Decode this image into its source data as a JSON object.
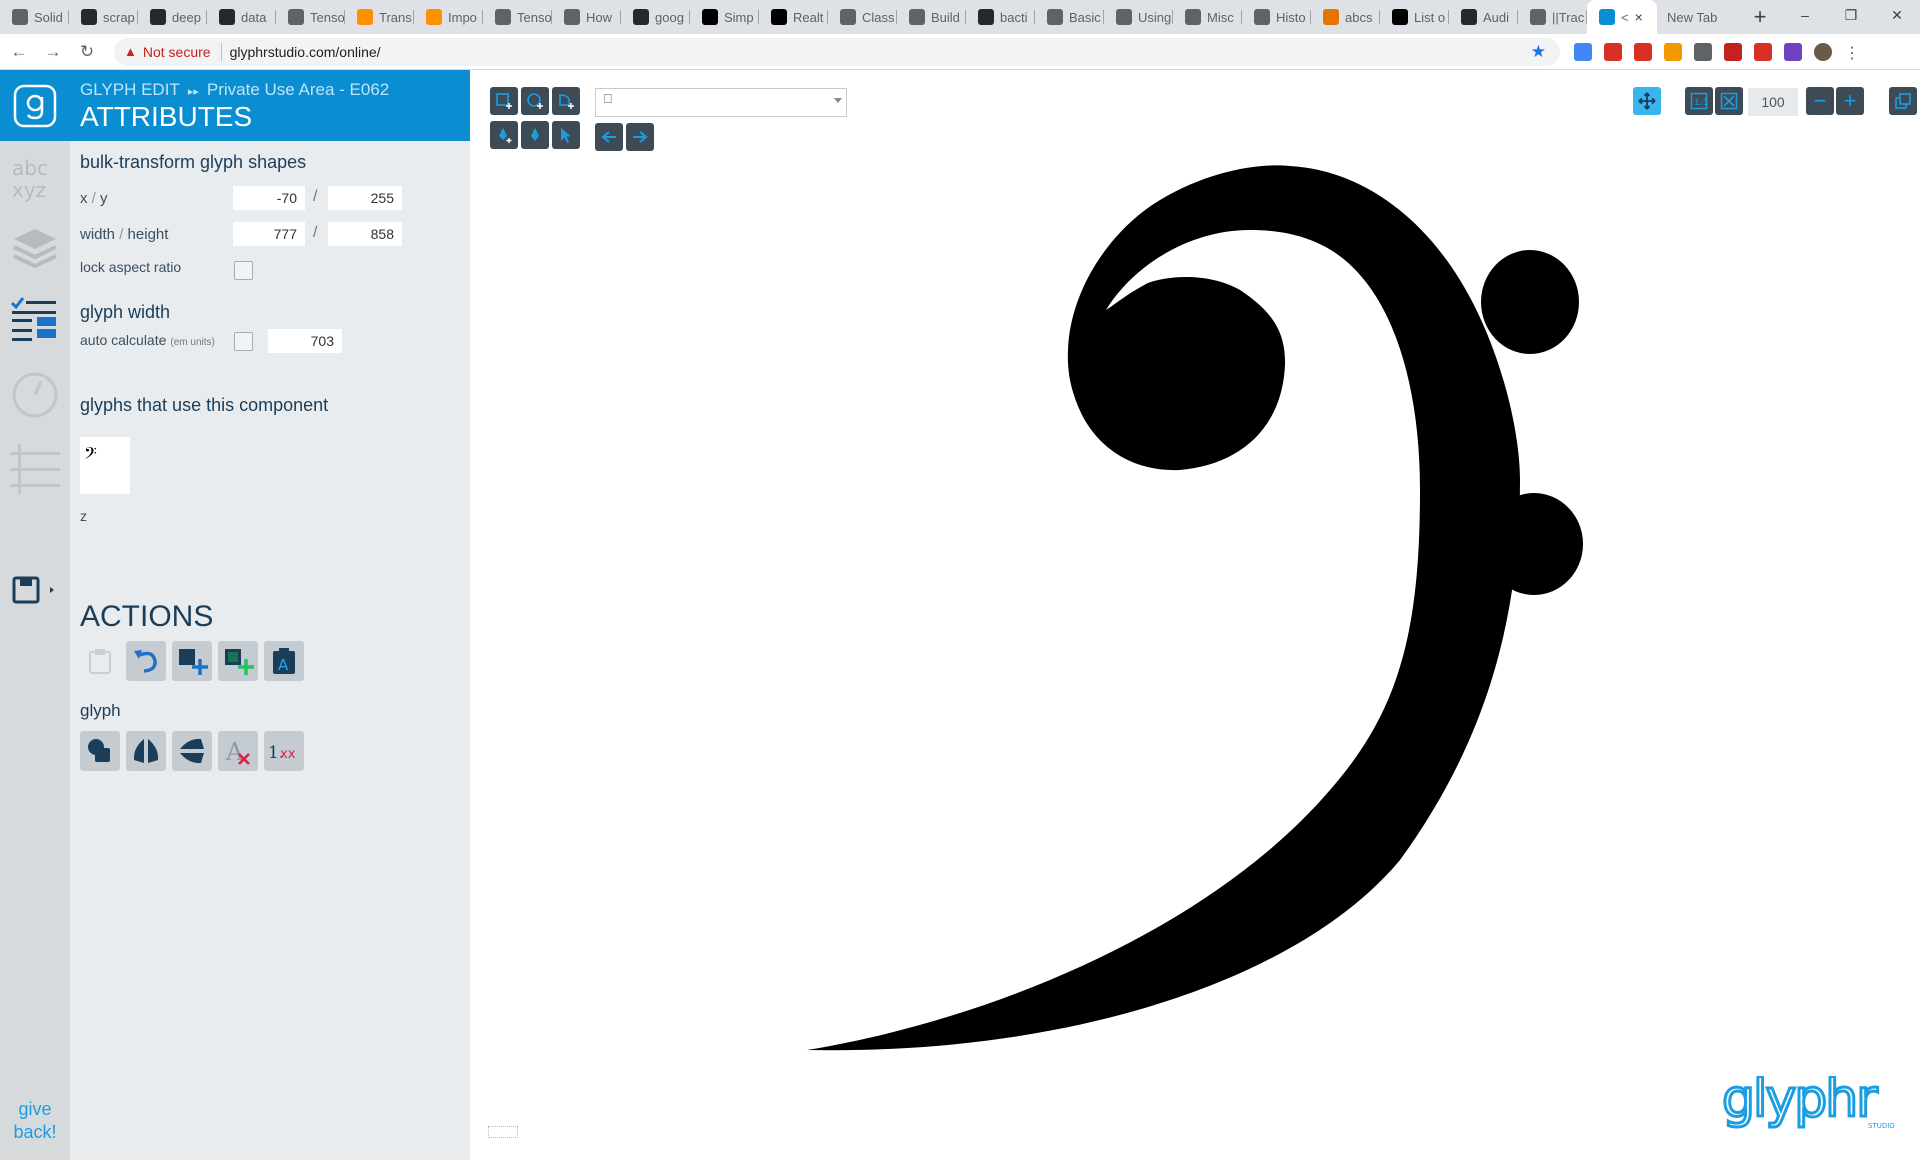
{
  "browser": {
    "tabs": [
      {
        "label": "Solid",
        "icon": "document-icon",
        "color": "#5f6368"
      },
      {
        "label": "scrap",
        "icon": "github-icon",
        "color": "#24292e"
      },
      {
        "label": "deep",
        "icon": "github-icon",
        "color": "#24292e"
      },
      {
        "label": "data",
        "icon": "github-icon",
        "color": "#24292e"
      },
      {
        "label": "Tenso",
        "icon": "globe-icon",
        "color": "#5f6368"
      },
      {
        "label": "Trans",
        "icon": "tensorflow-icon",
        "color": "#ff8f00"
      },
      {
        "label": "Impo",
        "icon": "tensorflow-icon",
        "color": "#ff8f00"
      },
      {
        "label": "Tenso",
        "icon": "code-icon",
        "color": "#5f6368"
      },
      {
        "label": "How",
        "icon": "circle-icon",
        "color": "#5f6368"
      },
      {
        "label": "goog",
        "icon": "github-icon",
        "color": "#24292e"
      },
      {
        "label": "Simp",
        "icon": "medium-icon",
        "color": "#000000"
      },
      {
        "label": "Realt",
        "icon": "medium-icon",
        "color": "#000000"
      },
      {
        "label": "Class",
        "icon": "globe-icon",
        "color": "#5f6368"
      },
      {
        "label": "Build",
        "icon": "book-icon",
        "color": "#5f6368"
      },
      {
        "label": "bacti",
        "icon": "github-icon",
        "color": "#24292e"
      },
      {
        "label": "Basic",
        "icon": "c-icon",
        "color": "#5f6368"
      },
      {
        "label": "Using",
        "icon": "c-icon",
        "color": "#5f6368"
      },
      {
        "label": "Misc",
        "icon": "globe-icon",
        "color": "#5f6368"
      },
      {
        "label": "Histo",
        "icon": "document-icon",
        "color": "#5f6368"
      },
      {
        "label": "abcs",
        "icon": "pencil-icon",
        "color": "#e37400"
      },
      {
        "label": "List o",
        "icon": "wikipedia-icon",
        "color": "#000000"
      },
      {
        "label": "Audi",
        "icon": "github-icon",
        "color": "#24292e"
      },
      {
        "label": "||Trac",
        "icon": "audio-icon",
        "color": "#5f6368"
      }
    ],
    "active_tab": {
      "label": "<",
      "close": "×",
      "icon": "glyphr-icon",
      "color": "#0a8ed1"
    },
    "new_tab": {
      "label": "New Tab"
    },
    "new_tab_button": "+",
    "window_controls": {
      "minimize": "–",
      "restore": "❐",
      "close": "✕"
    },
    "nav": {
      "back": "←",
      "forward": "→",
      "reload": "↻"
    },
    "address": {
      "warning_icon": "▲",
      "not_secure": "Not secure",
      "url": "glyphrstudio.com/online/",
      "star": "★"
    },
    "extensions": [
      "#4285f4",
      "#d93025",
      "#d93025",
      "#f29900",
      "#5f6368",
      "#c5221f",
      "#d93025",
      "#6f42c1"
    ]
  },
  "app": {
    "colors": {
      "accent": "#0a8ed1",
      "panel": "#e9ecee",
      "rail": "#d6dadd",
      "button": "#3d4b56"
    },
    "rail": {
      "give_back": "give back!"
    },
    "header": {
      "mode": "GLYPH EDIT",
      "location": "Private Use Area - E062",
      "title": "ATTRIBUTES",
      "separator": "▸▸"
    },
    "bulk": {
      "title": "bulk-transform glyph shapes",
      "xy_label": "x",
      "xy_sep": "/",
      "y_label": "y",
      "x": "-70",
      "y": "255",
      "wh_label": "width",
      "h_label": "height",
      "width": "777",
      "height": "858",
      "lock_label": "lock aspect ratio",
      "lock_checked": false
    },
    "glyph_width": {
      "title": "glyph width",
      "auto_label": "auto calculate",
      "auto_hint": "(em units)",
      "auto_checked": false,
      "value": "703"
    },
    "usage": {
      "title": "glyphs that use this component",
      "thumb_glyph": "𝄢",
      "item_label": "z"
    },
    "actions": {
      "title": "ACTIONS",
      "row1": [
        "paste-icon",
        "undo-icon",
        "add-shape-icon",
        "add-component-icon",
        "paste-glyph-icon"
      ],
      "glyph_label": "glyph",
      "row2": [
        "combine-icon",
        "flip-icon",
        "flip-horizontal-icon",
        "clear-glyph-icon",
        "round-values-icon"
      ]
    },
    "canvas": {
      "dropdown_value": "⎕",
      "zoom": "100",
      "zoom_minus": "−",
      "zoom_plus": "+",
      "brand": "glyphr"
    }
  }
}
